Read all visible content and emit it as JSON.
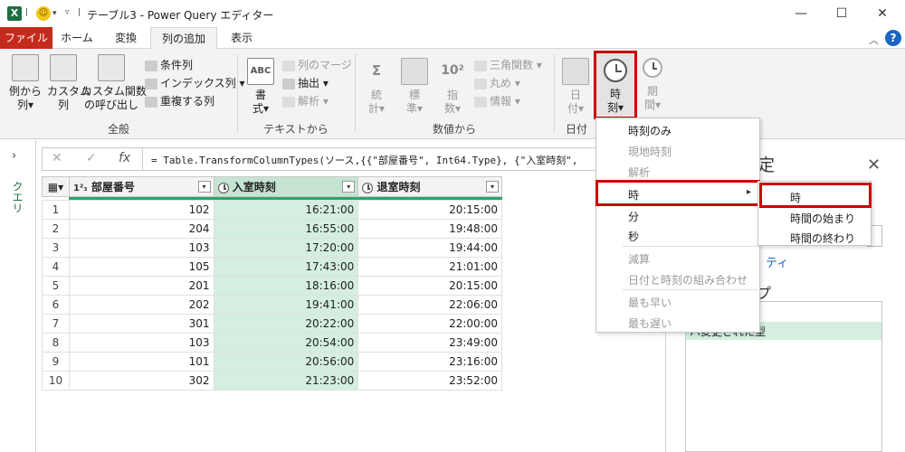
{
  "titlebar": {
    "app_icon": "X",
    "doc_title": "テーブル3 - Power Query エディター",
    "minimize": "—",
    "maximize": "☐",
    "close": "✕"
  },
  "tabs": [
    "ファイル",
    "ホーム",
    "変換",
    "列の追加",
    "表示"
  ],
  "ribbon": {
    "general": {
      "col_from_examples": "例から\n列▾",
      "custom_col": "カスタム\n列",
      "invoke_custom_fn": "カスタム関数\nの呼び出し",
      "conditional_col": "条件列",
      "index_col": "インデックス列 ▾",
      "duplicate_col": "重複する列",
      "label": "全般"
    },
    "text": {
      "format": "書\n式▾",
      "merge_cols": "列のマージ",
      "extract": "抽出 ▾",
      "parse": "解析 ▾",
      "label": "テキストから"
    },
    "number": {
      "statistics": "統\n計▾",
      "standard": "標\n準▾",
      "scientific": "指\n数▾",
      "trig": "三角関数 ▾",
      "rounding": "丸め ▾",
      "info": "情報 ▾",
      "label": "数値から"
    },
    "datetime": {
      "date": "日\n付▾",
      "time": "時\n刻▾",
      "duration": "期\n間▾",
      "label": "日付"
    }
  },
  "queries_label": "クエリ",
  "formula": "= Table.TransformColumnTypes(ソース,{{\"部屋番号\", Int64.Type}, {\"入室時刻\", ",
  "grid": {
    "headers": [
      {
        "type": "1²₃",
        "name": "部屋番号"
      },
      {
        "type": "clock",
        "name": "入室時刻"
      },
      {
        "type": "clock",
        "name": "退室時刻"
      }
    ],
    "rows": [
      [
        "1",
        "102",
        "16:21:00",
        "20:15:00"
      ],
      [
        "2",
        "204",
        "16:55:00",
        "19:48:00"
      ],
      [
        "3",
        "103",
        "17:20:00",
        "19:44:00"
      ],
      [
        "4",
        "105",
        "17:43:00",
        "21:01:00"
      ],
      [
        "5",
        "201",
        "18:16:00",
        "20:15:00"
      ],
      [
        "6",
        "202",
        "19:41:00",
        "22:06:00"
      ],
      [
        "7",
        "301",
        "20:22:00",
        "22:00:00"
      ],
      [
        "8",
        "103",
        "20:54:00",
        "23:49:00"
      ],
      [
        "9",
        "101",
        "20:56:00",
        "23:16:00"
      ],
      [
        "10",
        "302",
        "21:23:00",
        "23:52:00"
      ]
    ]
  },
  "settings": {
    "title": "設定",
    "properties_link": "ティ",
    "steps_heading": "プ",
    "selected_step": "ハ変更された型"
  },
  "menu": {
    "items": [
      "時刻のみ",
      "現地時刻",
      "解析",
      "時",
      "分",
      "秒",
      "減算",
      "日付と時刻の組み合わせ",
      "最も早い",
      "最も遅い"
    ],
    "submenu": [
      "時",
      "時間の始まり",
      "時間の終わり"
    ]
  },
  "colors": {
    "file_tab": "#c42b1c",
    "highlight": "#cc0000",
    "selected_column": "#d4eee0",
    "accent_green": "#2da56b"
  }
}
